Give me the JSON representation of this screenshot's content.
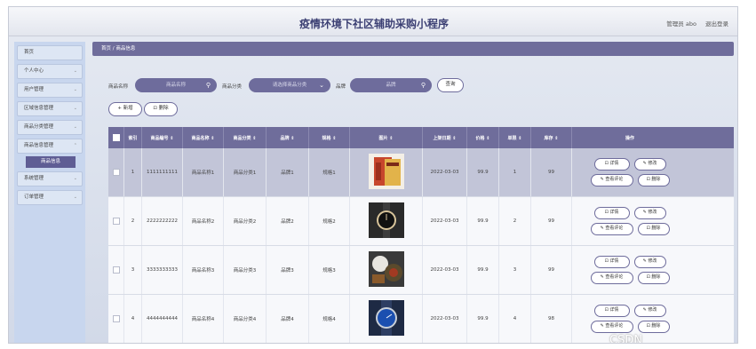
{
  "header": {
    "title": "疫情环境下社区辅助采购小程序",
    "user": "管理员 abo",
    "logout": "退出登录"
  },
  "sidebar": {
    "items": [
      {
        "label": "首页",
        "chev": ""
      },
      {
        "label": "个人中心",
        "chev": "⌄"
      },
      {
        "label": "用户管理",
        "chev": "⌄"
      },
      {
        "label": "区域信息管理",
        "chev": "⌄"
      },
      {
        "label": "商品分类管理",
        "chev": "⌄"
      },
      {
        "label": "商品信息管理",
        "chev": "⌃"
      }
    ],
    "active": "商品信息",
    "items_after": [
      {
        "label": "系统管理",
        "chev": "⌄"
      },
      {
        "label": "订单管理",
        "chev": "⌄"
      }
    ]
  },
  "breadcrumb": "首页 / 商品信息",
  "filters": {
    "name_label": "商品名称",
    "name_placeholder": "商品名称",
    "cat_label": "商品分类",
    "cat_placeholder": "请选择商品分类",
    "brand_label": "品牌",
    "brand_placeholder": "品牌",
    "query": "查询"
  },
  "actions": {
    "add": "+ 新增",
    "delete": "⊡ 删除"
  },
  "table": {
    "headers": [
      "",
      "索引",
      "商品编号 ⇕",
      "商品名称 ⇕",
      "商品分类 ⇕",
      "品牌 ⇕",
      "规格 ⇕",
      "图片 ⇕",
      "上架日期 ⇕",
      "价格 ⇕",
      "单限 ⇕",
      "库存 ⇕",
      "操作"
    ],
    "rows": [
      {
        "idx": "1",
        "code": "1111111111",
        "name": "商品名称1",
        "cat": "商品分类1",
        "brand": "品牌1",
        "spec": "规格1",
        "date": "2022-03-03",
        "price": "99.9",
        "limit": "1",
        "stock": "99"
      },
      {
        "idx": "2",
        "code": "2222222222",
        "name": "商品名称2",
        "cat": "商品分类2",
        "brand": "品牌2",
        "spec": "规格2",
        "date": "2022-03-03",
        "price": "99.9",
        "limit": "2",
        "stock": "99"
      },
      {
        "idx": "3",
        "code": "3333333333",
        "name": "商品名称3",
        "cat": "商品分类3",
        "brand": "品牌3",
        "spec": "规格3",
        "date": "2022-03-03",
        "price": "99.9",
        "limit": "3",
        "stock": "99"
      },
      {
        "idx": "4",
        "code": "4444444444",
        "name": "商品名称4",
        "cat": "商品分类4",
        "brand": "品牌4",
        "spec": "规格4",
        "date": "2022-03-03",
        "price": "99.9",
        "limit": "4",
        "stock": "98"
      }
    ],
    "ops": {
      "detail": "⊡ 详情",
      "edit": "✎ 修改",
      "review": "✎ 查看评论",
      "del": "⊡ 删除"
    }
  },
  "watermark": "CSDN @springboot999"
}
